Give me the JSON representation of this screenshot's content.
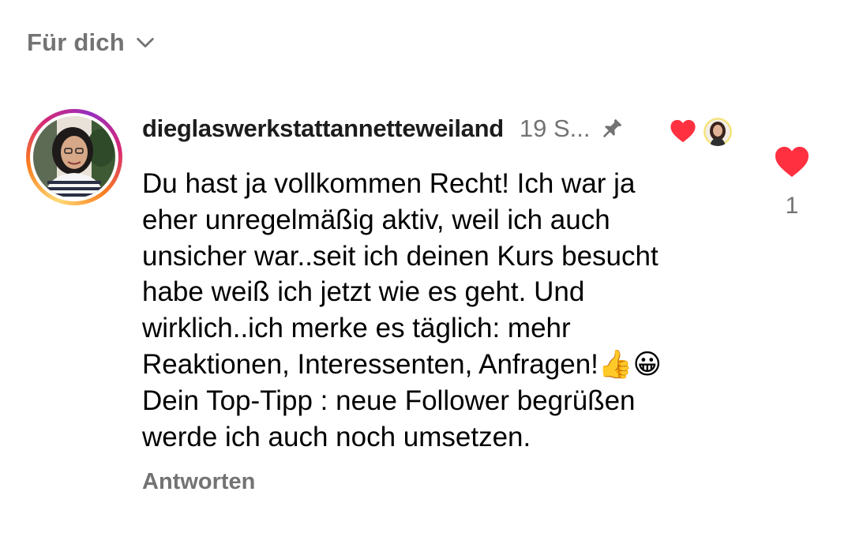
{
  "feed": {
    "filter_label": "Für dich",
    "filter_icon": "chevron-down-icon"
  },
  "comment": {
    "username": "dieglaswerkstattannetteweiland",
    "timestamp": "19 S...",
    "pinned_icon": "pin-icon",
    "creator_liked_icon": "heart-icon",
    "text": "Du hast ja vollkommen Recht! Ich war ja\neher unregelmäßig aktiv, weil ich auch\nunsicher war..seit ich deinen Kurs besucht\nhabe weiß ich jetzt wie es geht. Und\nwirklich..ich merke es täglich: mehr\nReaktionen, Interessenten, Anfragen!👍😀\nDein Top-Tipp : neue Follower begrüßen\nwerde ich auch noch umsetzen.",
    "like_count": "1",
    "reply_label": "Antworten"
  },
  "colors": {
    "heart": "#ff3040",
    "muted_text": "#737373",
    "story_ring": [
      "#feda75",
      "#fa7e1e",
      "#d62976",
      "#962fbf"
    ]
  }
}
